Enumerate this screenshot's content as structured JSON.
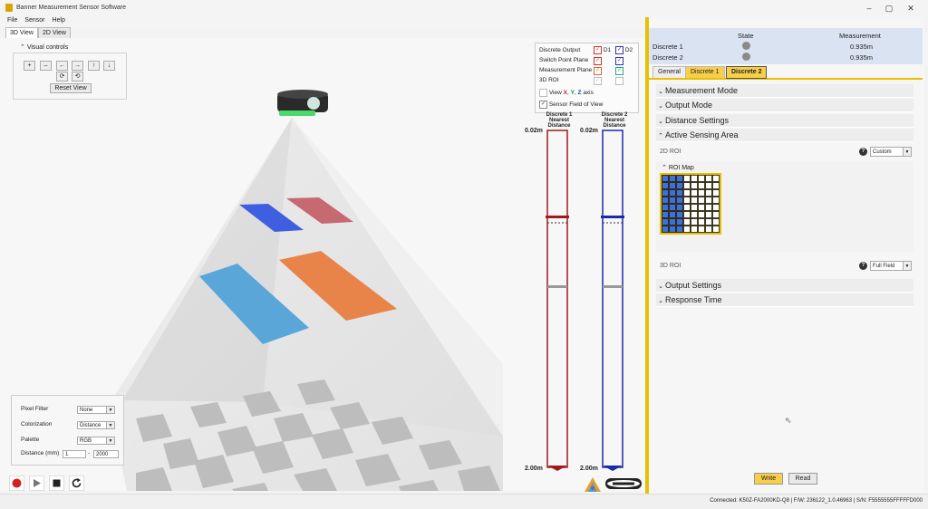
{
  "window": {
    "title": "Banner Measurement Sensor Software",
    "controls": [
      "–",
      "▢",
      "✕"
    ]
  },
  "menu": [
    "File",
    "Sensor",
    "Help"
  ],
  "view_tabs": [
    "3D View",
    "2D View"
  ],
  "visual_controls": {
    "label": "Visual controls",
    "buttons_row1": [
      "+",
      "–",
      "←",
      "→",
      "↑",
      "↓"
    ],
    "buttons_row2": [
      "⟳",
      "⟲"
    ],
    "reset_label": "Reset View"
  },
  "legend": {
    "col_d1": "D1",
    "col_d2": "D2",
    "rows": [
      {
        "label": "Discrete Output",
        "d1": "✓",
        "d2": "✓"
      },
      {
        "label": "Switch Point Plane",
        "d1": "✓",
        "d2": "✓"
      },
      {
        "label": "Measurement Plane",
        "d1": "✓",
        "d2": "✓"
      },
      {
        "label": "3D ROI",
        "d1": "✓",
        "d2": ""
      }
    ],
    "view_xyz_prefix": "View ",
    "axis_x": "X",
    "axis_y": "Y",
    "axis_z": "Z",
    "view_xyz_suffix": " axis",
    "sensor_fov": "Sensor Field of View"
  },
  "bars": {
    "d1": {
      "title1": "Discrete 1",
      "title2": "Nearest Distance",
      "top": "0.02m",
      "bottom": "2.00m",
      "color": "#a11a1a"
    },
    "d2": {
      "title1": "Discrete 2",
      "title2": "Nearest Distance",
      "top": "0.02m",
      "bottom": "2.00m",
      "color": "#1a2aa8"
    }
  },
  "render_panel": {
    "pixel_filter_label": "Pixel Filter",
    "pixel_filter_value": "None",
    "colorization_label": "Colorization",
    "colorization_value": "Distance",
    "palette_label": "Palette",
    "palette_value": "RGB",
    "distance_label": "Distance (mm)",
    "distance_min": "1",
    "distance_sep": "-",
    "distance_max": "2000"
  },
  "right": {
    "table": {
      "col_state": "State",
      "col_measurement": "Measurement",
      "rows": [
        {
          "name": "Discrete 1",
          "measurement": "0.935m"
        },
        {
          "name": "Discrete 2",
          "measurement": "0.935m"
        }
      ]
    },
    "tabs": [
      "General",
      "Discrete 1",
      "Discrete 2"
    ],
    "sections": {
      "measurement_mode": "Measurement Mode",
      "output_mode": "Output Mode",
      "distance_settings": "Distance Settings",
      "active_sensing_area": "Active Sensing Area",
      "output_settings": "Output Settings",
      "response_time": "Response Time"
    },
    "roi2d_label": "2D ROI",
    "roi2d_value": "Custom",
    "roi_map_label": "ROI Map",
    "roi3d_label": "3D ROI",
    "roi3d_value": "Full Field",
    "write_label": "Write",
    "read_label": "Read"
  },
  "status": "Connected: K50Z-FA2000KD-Q8  |  F/W: 236122_1.0.46963  |  S/N: F5555555FFFFFD000",
  "colors": {
    "accent": "#e8c000",
    "roi_blue": "#3f6fd8",
    "plane_blue": "#5aa6d8",
    "plane_orange": "#e8834a"
  }
}
